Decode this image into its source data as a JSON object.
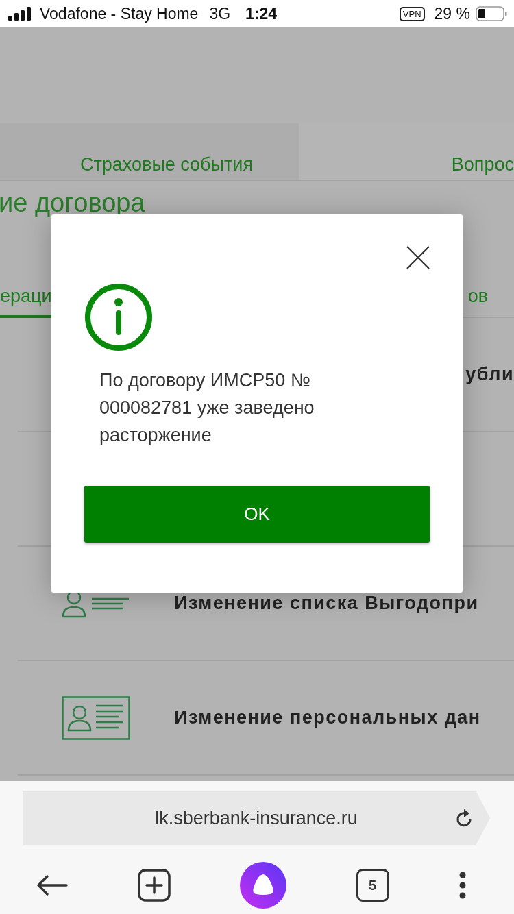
{
  "status_bar": {
    "carrier": "Vodafone - Stay Home",
    "network": "3G",
    "time": "1:24",
    "vpn": "VPN",
    "battery": "29 %"
  },
  "page": {
    "tabs": [
      {
        "label": "Страховые события",
        "selected": false
      },
      {
        "label": "Вопрос",
        "selected": true
      }
    ],
    "heading": "ие договора",
    "subtabs": [
      {
        "label": "ераци",
        "selected": true
      },
      {
        "label": "ов",
        "selected": false
      }
    ],
    "operations": [
      {
        "title": "убли"
      },
      {
        "title": "Изменение списка Выгодопри",
        "kind": "beneficiary"
      },
      {
        "title": "Изменение персональных дан",
        "kind": "id-card"
      }
    ]
  },
  "dialog": {
    "message": "По договору ИМСР50 № 000082781 уже заведено расторжение",
    "button": "OK"
  },
  "browser": {
    "url": "lk.sberbank-insurance.ru",
    "tab_count": "5"
  }
}
